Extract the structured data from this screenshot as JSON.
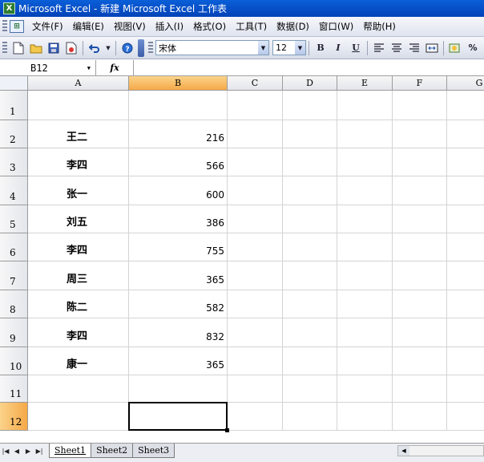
{
  "window": {
    "title": "Microsoft Excel - 新建 Microsoft Excel 工作表",
    "app_icon": "excel-icon"
  },
  "menu": [
    "文件(F)",
    "编辑(E)",
    "视图(V)",
    "插入(I)",
    "格式(O)",
    "工具(T)",
    "数据(D)",
    "窗口(W)",
    "帮助(H)"
  ],
  "toolbar": {
    "font_name": "宋体",
    "font_size": "12",
    "bold_label": "B",
    "italic_label": "I",
    "underline_label": "U",
    "percent_label": "%"
  },
  "formula_bar": {
    "name_box": "B12",
    "fx_label": "fx",
    "formula": ""
  },
  "grid": {
    "columns": [
      "A",
      "B",
      "C",
      "D",
      "E",
      "F",
      "G"
    ],
    "selected_column": "B",
    "rows": [
      {
        "num": "1",
        "name": "",
        "value": ""
      },
      {
        "num": "2",
        "name": "王二",
        "value": "216"
      },
      {
        "num": "3",
        "name": "李四",
        "value": "566"
      },
      {
        "num": "4",
        "name": "张一",
        "value": "600"
      },
      {
        "num": "5",
        "name": "刘五",
        "value": "386"
      },
      {
        "num": "6",
        "name": "李四",
        "value": "755"
      },
      {
        "num": "7",
        "name": "周三",
        "value": "365"
      },
      {
        "num": "8",
        "name": "陈二",
        "value": "582"
      },
      {
        "num": "9",
        "name": "李四",
        "value": "832"
      },
      {
        "num": "10",
        "name": "康一",
        "value": "365"
      },
      {
        "num": "11",
        "name": "",
        "value": ""
      },
      {
        "num": "12",
        "name": "",
        "value": ""
      }
    ],
    "active_cell": "B12",
    "selected_row": "12"
  },
  "sheets": {
    "tabs": [
      "Sheet1",
      "Sheet2",
      "Sheet3"
    ],
    "active": "Sheet1"
  },
  "colors": {
    "title_bar": "#0553cf",
    "header_selected": "#f8b864",
    "grid_line": "#d4d4d4"
  }
}
